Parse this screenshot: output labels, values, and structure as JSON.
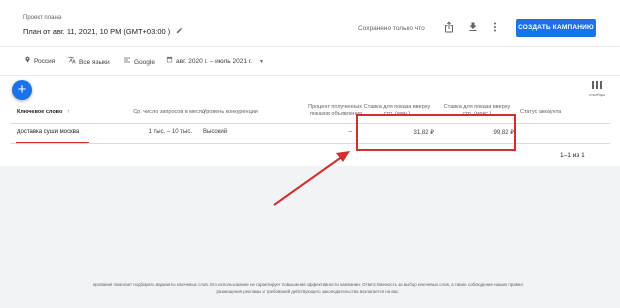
{
  "header": {
    "plan_label": "Проект плана",
    "plan_title": "План от авг. 11, 2021, 10 PM (GMT+03:00 )",
    "saved_text": "Сохранено только что",
    "create_button": "СОЗДАТЬ КАМПАНИЮ",
    "icons": [
      "share-icon",
      "download-icon",
      "more-vert-icon"
    ]
  },
  "filters": {
    "location": "Россия",
    "language": "Все языки",
    "network": "Google",
    "date_range": "авг. 2020 г. – июль 2021 г."
  },
  "toolbar": {
    "add_symbol": "+",
    "columns_label": "столбцы"
  },
  "table": {
    "headers": {
      "keyword": "Ключевое слово",
      "keyword_sort": "↑",
      "avg_searches": "Ср. число запросов в месяц",
      "competition": "Уровень конкуренции",
      "impr_share_1": "Процент полученных",
      "impr_share_2": "показов объявления",
      "bid_low_1": "Ставка для показа вверху",
      "bid_low_2": "стр. (мин.)",
      "bid_high_1": "Ставка для показа вверху",
      "bid_high_2": "стр. (макс.)",
      "account_status": "Статус аккаунта"
    },
    "rows": [
      {
        "keyword": "доставка суши москва",
        "avg_searches": "1 тыс. – 10 тыс.",
        "competition": "Высокий",
        "impr_share": "–",
        "bid_low": "31,82 ₽",
        "bid_high": "99,82 ₽",
        "account_status": ""
      }
    ],
    "pagination": "1–1 из 1"
  },
  "footer": {
    "line1": "ирования помогает подбирать варианты ключевых слов. Его использование не гарантирует повышения эффективности кампании. Ответственность за выбор ключевых слов, а также соблюдение наших правил",
    "line2": "размещения рекламы и требований действующего законодательства возлагается на вас."
  },
  "colors": {
    "primary": "#1a73e8",
    "annotation": "#d32f2f",
    "background_grey": "#f1f3f4"
  }
}
